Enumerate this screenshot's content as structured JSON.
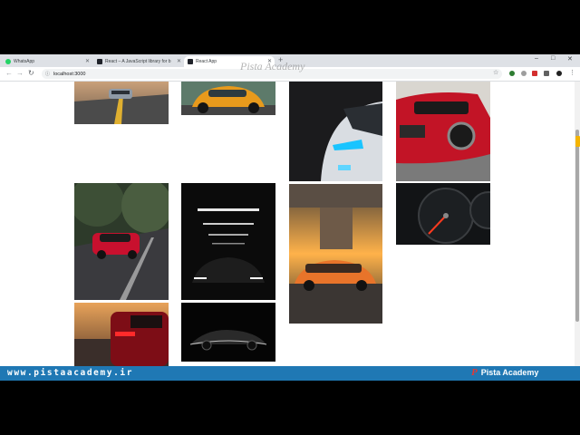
{
  "browser": {
    "tabs": [
      {
        "label": "WhatsApp",
        "favicon_color": "#25d366",
        "active": false
      },
      {
        "label": "React – A JavaScript library for b",
        "favicon_color": "#20232a",
        "active": false
      },
      {
        "label": "React App",
        "favicon_color": "#20232a",
        "active": true
      }
    ],
    "new_tab_symbol": "+",
    "window_controls": [
      "–",
      "□",
      "✕"
    ],
    "address": "localhost:3000",
    "nav_icons": [
      "back-icon",
      "forward-icon",
      "reload-icon"
    ]
  },
  "watermark": "Pista Academy",
  "gallery": {
    "images": [
      {
        "name": "photo-silver-car-road"
      },
      {
        "name": "photo-orange-beetle"
      },
      {
        "name": "photo-car-headlight"
      },
      {
        "name": "photo-red-hatchback"
      },
      {
        "name": "photo-red-audi-road"
      },
      {
        "name": "photo-dark-tunnel-car"
      },
      {
        "name": "photo-orange-audi-bridge"
      },
      {
        "name": "photo-speedometer"
      },
      {
        "name": "photo-red-car-sunset"
      },
      {
        "name": "photo-black-coupe"
      }
    ]
  },
  "banner": {
    "url_text": "www.pistaacademy.ir",
    "brand_text": "Pista Academy",
    "brand_logo": "P",
    "color": "#1f78b4"
  }
}
